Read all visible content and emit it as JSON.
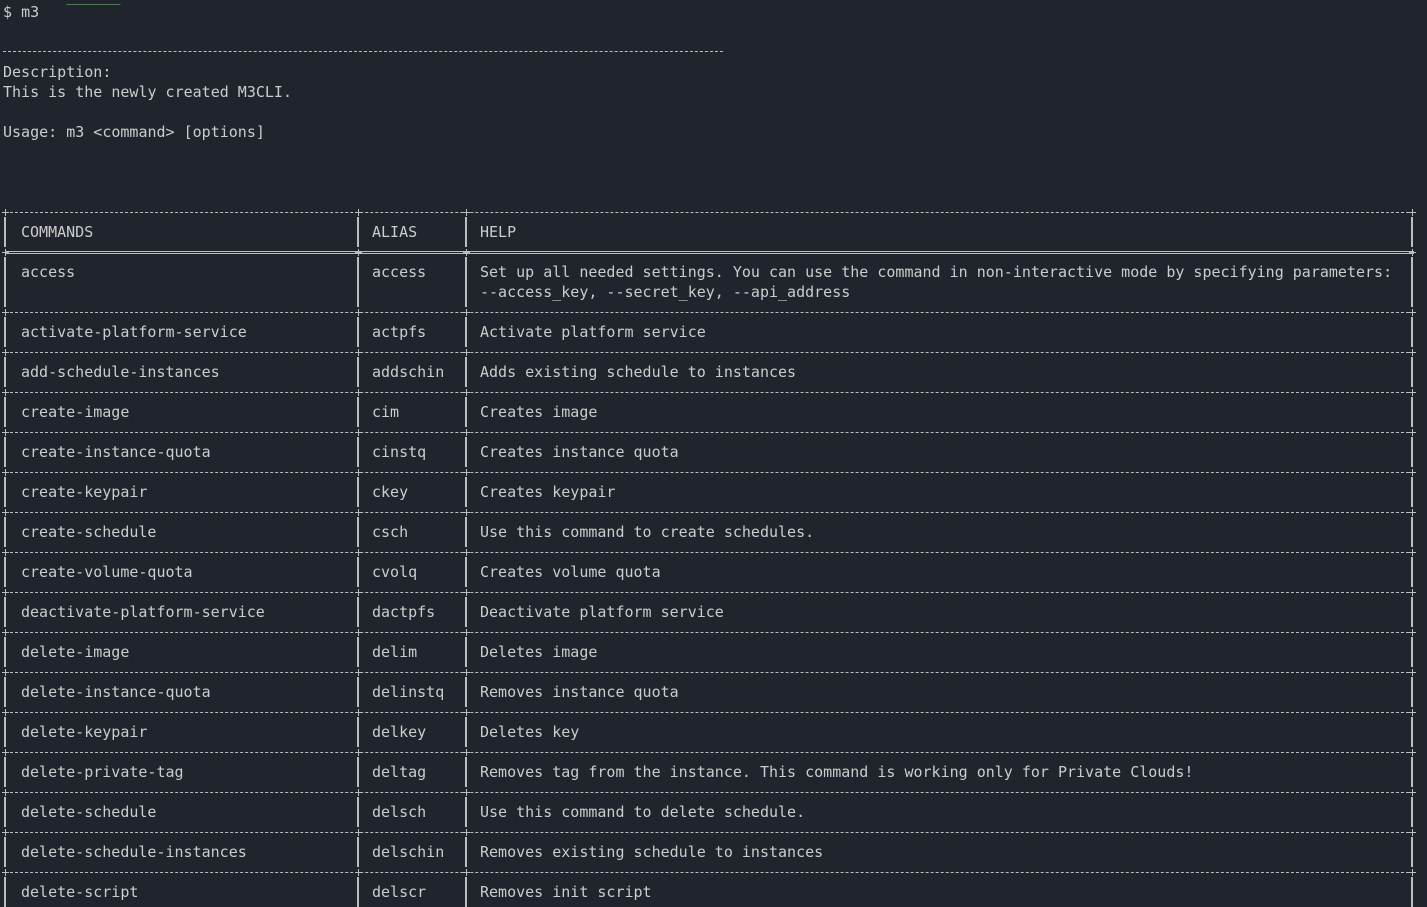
{
  "prompt": {
    "symbol": "$",
    "command": "m3"
  },
  "description": {
    "label": "Description:",
    "text": "This is the newly created M3CLI."
  },
  "usage": "Usage: m3 <command> [options]",
  "table": {
    "headers": [
      "COMMANDS",
      "ALIAS",
      "HELP"
    ],
    "rows": [
      {
        "command": "access",
        "alias": "access",
        "help": [
          "Set up all needed settings. You can use the command in non-interactive mode by specifying parameters:",
          "--access_key, --secret_key, --api_address"
        ]
      },
      {
        "command": "activate-platform-service",
        "alias": "actpfs",
        "help": [
          "Activate platform service"
        ]
      },
      {
        "command": "add-schedule-instances",
        "alias": "addschin",
        "help": [
          "Adds existing schedule to instances"
        ]
      },
      {
        "command": "create-image",
        "alias": "cim",
        "help": [
          "Creates image"
        ]
      },
      {
        "command": "create-instance-quota",
        "alias": "cinstq",
        "help": [
          "Creates instance quota"
        ]
      },
      {
        "command": "create-keypair",
        "alias": "ckey",
        "help": [
          "Creates keypair"
        ]
      },
      {
        "command": "create-schedule",
        "alias": "csch",
        "help": [
          "Use this command to create schedules."
        ]
      },
      {
        "command": "create-volume-quota",
        "alias": "cvolq",
        "help": [
          "Creates volume quota"
        ]
      },
      {
        "command": "deactivate-platform-service",
        "alias": "dactpfs",
        "help": [
          "Deactivate platform service"
        ]
      },
      {
        "command": "delete-image",
        "alias": "delim",
        "help": [
          "Deletes image"
        ]
      },
      {
        "command": "delete-instance-quota",
        "alias": "delinstq",
        "help": [
          "Removes instance quota"
        ]
      },
      {
        "command": "delete-keypair",
        "alias": "delkey",
        "help": [
          "Deletes key"
        ]
      },
      {
        "command": "delete-private-tag",
        "alias": "deltag",
        "help": [
          "Removes tag from the instance. This command is working only for Private Clouds!"
        ]
      },
      {
        "command": "delete-schedule",
        "alias": "delsch",
        "help": [
          "Use this command to delete schedule."
        ]
      },
      {
        "command": "delete-schedule-instances",
        "alias": "delschin",
        "help": [
          "Removes existing schedule to instances"
        ]
      },
      {
        "command": "delete-script",
        "alias": "delscr",
        "help": [
          "Removes init script"
        ]
      }
    ]
  },
  "colors": {
    "background": "#20242c",
    "text": "#cccccc",
    "border": "#bdbdbd",
    "prompt_green": "#4ec94e",
    "prompt_yellow": "#d7c84a"
  }
}
